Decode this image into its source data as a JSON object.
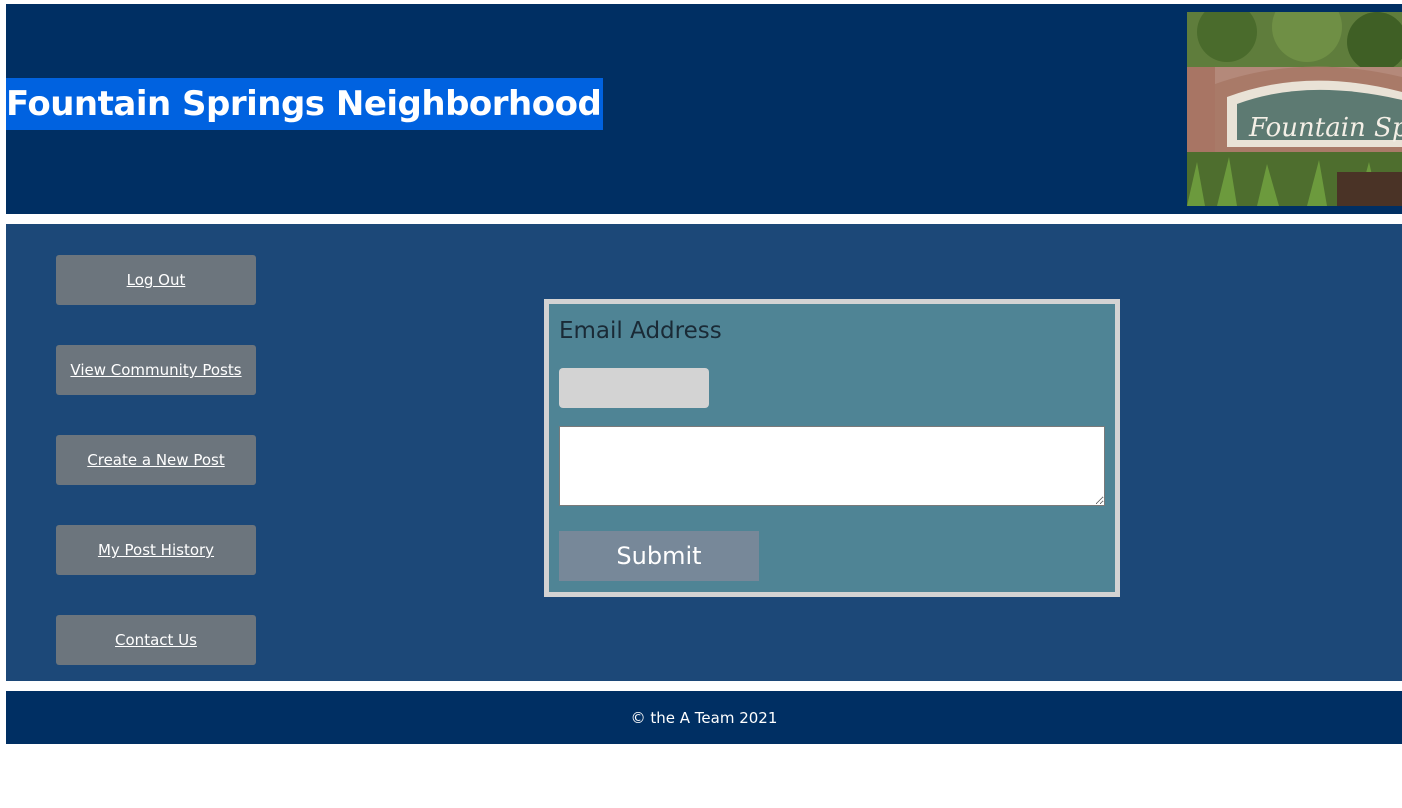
{
  "header": {
    "title": "Fountain Springs Neighborhood",
    "photo_icon": "neighborhood-sign-photo",
    "sign_text": "Fountain Springs"
  },
  "nav": {
    "items": [
      {
        "label": "Log Out"
      },
      {
        "label": "View Community Posts"
      },
      {
        "label": "Create a New Post"
      },
      {
        "label": "My Post History"
      },
      {
        "label": "Contact Us"
      }
    ]
  },
  "form": {
    "email_label": "Email Address",
    "email_value": "",
    "message_value": "",
    "submit_label": "Submit"
  },
  "footer": {
    "copyright": "© the A Team 2021"
  },
  "colors": {
    "header_bg": "#002f63",
    "title_highlight": "#0062e0",
    "main_bg": "#1c4878",
    "nav_button": "#6c757d",
    "form_bg": "#4f8495",
    "form_border": "#d3d3d3",
    "submit_button": "#778899"
  }
}
